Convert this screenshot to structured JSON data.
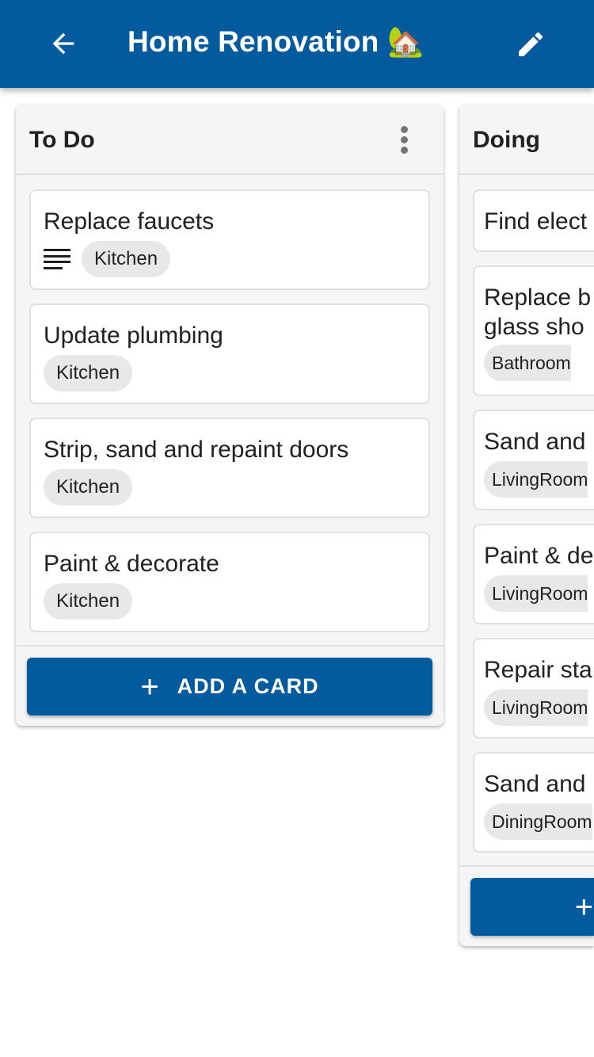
{
  "header": {
    "title": "Home Renovation 🏡",
    "back_icon": "arrow-back-icon",
    "edit_icon": "pencil-icon"
  },
  "columns": [
    {
      "name": "To Do",
      "add_label": "ADD A CARD",
      "add_icon": "+",
      "cards": [
        {
          "title": "Replace faucets",
          "label": "Kitchen",
          "has_description": true
        },
        {
          "title": "Update plumbing",
          "label": "Kitchen"
        },
        {
          "title": "Strip, sand and repaint doors",
          "label": "Kitchen"
        },
        {
          "title": "Paint & decorate",
          "label": "Kitchen"
        }
      ]
    },
    {
      "name": "Doing",
      "add_icon": "+",
      "cards": [
        {
          "title": "Find elect"
        },
        {
          "title": "Replace b",
          "title2": "glass sho",
          "label": "Bathroom"
        },
        {
          "title": "Sand and",
          "label": "LivingRoom"
        },
        {
          "title": "Paint & de",
          "label": "LivingRoom"
        },
        {
          "title": "Repair sta",
          "label": "LivingRoom"
        },
        {
          "title": "Sand and",
          "label": "DiningRoom"
        }
      ]
    }
  ],
  "colors": {
    "primary": "#035a9d",
    "column_bg": "#f5f5f5",
    "chip_bg": "#e8e8e8"
  }
}
